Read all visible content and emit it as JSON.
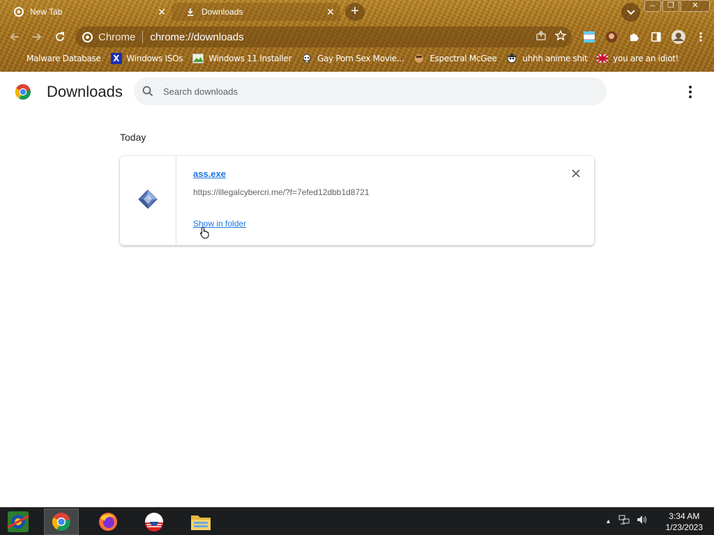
{
  "tabs": [
    {
      "title": "New Tab",
      "icon": "chrome-icon"
    },
    {
      "title": "Downloads",
      "icon": "download-icon"
    }
  ],
  "omnibox": {
    "site_name": "Chrome",
    "url": "chrome://downloads"
  },
  "bookmarks": [
    {
      "label": "Malware Database"
    },
    {
      "label": "Windows ISOs"
    },
    {
      "label": "Windows 11 Installer"
    },
    {
      "label": "Gay Porn Sex Movie..."
    },
    {
      "label": "Espectral McGee"
    },
    {
      "label": "uhhh anime shit"
    },
    {
      "label": "you are an idiot!"
    }
  ],
  "page": {
    "title": "Downloads",
    "search_placeholder": "Search downloads",
    "date_heading": "Today"
  },
  "download": {
    "file_name": "ass.exe",
    "url": "https://illegalcybercri.me/?f=7efed12dbb1d8721",
    "action": "Show in folder"
  },
  "taskbar": {
    "time": "3:34 AM",
    "date": "1/23/2023"
  },
  "colors": {
    "link": "#1a73e8",
    "chrome_frame": "#a6731f"
  }
}
